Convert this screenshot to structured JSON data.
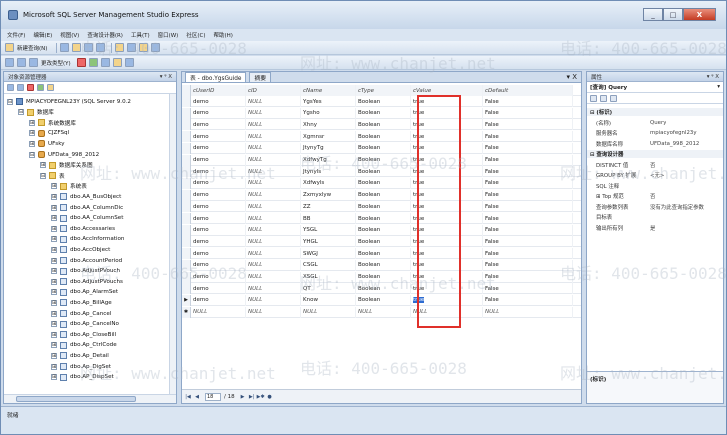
{
  "window": {
    "title": "Microsoft SQL Server Management Studio Express",
    "min": "_",
    "max": "□",
    "close": "X"
  },
  "menu": [
    "文件(F)",
    "编辑(E)",
    "视图(V)",
    "查询设计器(R)",
    "工具(T)",
    "窗口(W)",
    "社区(C)",
    "帮助(H)"
  ],
  "toolbar1": {
    "new_query": "新建查询(N)"
  },
  "toolbar2": {
    "change_type": "更改类型(Y)"
  },
  "object_explorer": {
    "title": "对象资源管理器",
    "controls": "▾ ᵠ X",
    "tree": [
      {
        "label": "MPIACYOFEGNL23Y (SQL Server 9.0.2",
        "exp": "⊟",
        "icon": "server",
        "level": 0
      },
      {
        "label": "数据库",
        "exp": "⊟",
        "icon": "folder",
        "level": 1
      },
      {
        "label": "系统数据库",
        "exp": "⊞",
        "icon": "folder",
        "level": 2
      },
      {
        "label": "CJZFSql",
        "exp": "⊞",
        "icon": "db",
        "level": 2
      },
      {
        "label": "UFsky",
        "exp": "⊞",
        "icon": "db",
        "level": 2
      },
      {
        "label": "UFData_998_2012",
        "exp": "⊟",
        "icon": "db",
        "level": 2
      },
      {
        "label": "数据库关系图",
        "exp": "⊞",
        "icon": "folder",
        "level": 3
      },
      {
        "label": "表",
        "exp": "⊟",
        "icon": "folder",
        "level": 3
      },
      {
        "label": "系统表",
        "exp": "⊞",
        "icon": "folder",
        "level": 4
      },
      {
        "label": "dbo.AA_BusObject",
        "exp": "⊞",
        "icon": "table",
        "level": 4
      },
      {
        "label": "dbo.AA_ColumnDic",
        "exp": "⊞",
        "icon": "table",
        "level": 4
      },
      {
        "label": "dbo.AA_ColumnSet",
        "exp": "⊞",
        "icon": "table",
        "level": 4
      },
      {
        "label": "dbo.Accessaries",
        "exp": "⊞",
        "icon": "table",
        "level": 4
      },
      {
        "label": "dbo.AccInformation",
        "exp": "⊞",
        "icon": "table",
        "level": 4
      },
      {
        "label": "dbo.AccObject",
        "exp": "⊞",
        "icon": "table",
        "level": 4
      },
      {
        "label": "dbo.AccountPeriod",
        "exp": "⊞",
        "icon": "table",
        "level": 4
      },
      {
        "label": "dbo.AdjustPVouch",
        "exp": "⊞",
        "icon": "table",
        "level": 4
      },
      {
        "label": "dbo.AdjustPVouchs",
        "exp": "⊞",
        "icon": "table",
        "level": 4
      },
      {
        "label": "dbo.Ap_AlarmSet",
        "exp": "⊞",
        "icon": "table",
        "level": 4
      },
      {
        "label": "dbo.Ap_BillAge",
        "exp": "⊞",
        "icon": "table",
        "level": 4
      },
      {
        "label": "dbo.Ap_Cancel",
        "exp": "⊞",
        "icon": "table",
        "level": 4
      },
      {
        "label": "dbo.Ap_CancelNo",
        "exp": "⊞",
        "icon": "table",
        "level": 4
      },
      {
        "label": "dbo.Ap_CloseBill",
        "exp": "⊞",
        "icon": "table",
        "level": 4
      },
      {
        "label": "dbo.Ap_CtrlCode",
        "exp": "⊞",
        "icon": "table",
        "level": 4
      },
      {
        "label": "dbo.Ap_Detail",
        "exp": "⊞",
        "icon": "table",
        "level": 4
      },
      {
        "label": "dbo.Ap_DigSet",
        "exp": "⊞",
        "icon": "table",
        "level": 4
      },
      {
        "label": "dbo.AP_DispSet",
        "exp": "⊞",
        "icon": "table",
        "level": 4
      }
    ]
  },
  "editor": {
    "tab_active": "表 - dbo.YgsGuide",
    "tab_inactive": "摘要",
    "tab_controls": "▾ X",
    "columns": [
      "cUserID",
      "cID",
      "cName",
      "cType",
      "cValue",
      "cDefault"
    ],
    "rows": [
      {
        "sel": "",
        "cells": [
          "demo",
          "NULL",
          "YgsYes",
          "Boolean",
          "true",
          "False"
        ]
      },
      {
        "sel": "",
        "cells": [
          "demo",
          "NULL",
          "Ygsho",
          "Boolean",
          "true",
          "False"
        ]
      },
      {
        "sel": "",
        "cells": [
          "demo",
          "NULL",
          "Xhny",
          "Boolean",
          "true",
          "False"
        ]
      },
      {
        "sel": "",
        "cells": [
          "demo",
          "NULL",
          "Xgmnsr",
          "Boolean",
          "true",
          "False"
        ]
      },
      {
        "sel": "",
        "cells": [
          "demo",
          "NULL",
          "JtynyTg",
          "Boolean",
          "true",
          "False"
        ]
      },
      {
        "sel": "",
        "cells": [
          "demo",
          "NULL",
          "XdfwyTg",
          "Boolean",
          "true",
          "False"
        ]
      },
      {
        "sel": "",
        "cells": [
          "demo",
          "NULL",
          "Jtynyls",
          "Boolean",
          "true",
          "False"
        ]
      },
      {
        "sel": "",
        "cells": [
          "demo",
          "NULL",
          "Xdfwyls",
          "Boolean",
          "true",
          "False"
        ]
      },
      {
        "sel": "",
        "cells": [
          "demo",
          "NULL",
          "Zxmyxlyw",
          "Boolean",
          "true",
          "False"
        ]
      },
      {
        "sel": "",
        "cells": [
          "demo",
          "NULL",
          "ZZ",
          "Boolean",
          "true",
          "False"
        ]
      },
      {
        "sel": "",
        "cells": [
          "demo",
          "NULL",
          "BB",
          "Boolean",
          "true",
          "False"
        ]
      },
      {
        "sel": "",
        "cells": [
          "demo",
          "NULL",
          "YSGL",
          "Boolean",
          "true",
          "False"
        ]
      },
      {
        "sel": "",
        "cells": [
          "demo",
          "NULL",
          "YHGL",
          "Boolean",
          "true",
          "False"
        ]
      },
      {
        "sel": "",
        "cells": [
          "demo",
          "NULL",
          "SWGJ",
          "Boolean",
          "true",
          "False"
        ]
      },
      {
        "sel": "",
        "cells": [
          "demo",
          "NULL",
          "CSGL",
          "Boolean",
          "true",
          "False"
        ]
      },
      {
        "sel": "",
        "cells": [
          "demo",
          "NULL",
          "XSGL",
          "Boolean",
          "true",
          "False"
        ]
      },
      {
        "sel": "",
        "cells": [
          "demo",
          "NULL",
          "QT",
          "Boolean",
          "true",
          "False"
        ]
      },
      {
        "sel": "▶",
        "cells": [
          "demo",
          "NULL",
          "Know",
          "Boolean",
          "true",
          "False"
        ]
      },
      {
        "sel": "✱",
        "cells": [
          "NULL",
          "NULL",
          "NULL",
          "NULL",
          "NULL",
          "NULL"
        ]
      }
    ],
    "nav": {
      "first": "|◀",
      "prev": "◀",
      "current": "18",
      "of": "/ 18",
      "next": "▶",
      "last": "▶|",
      "new": "▶✱",
      "stop": "●"
    }
  },
  "properties": {
    "title": "属性",
    "controls": "▾ ᵠ X",
    "selected": "[查询] Query",
    "rows": [
      {
        "type": "cat",
        "k": "⊟ (标识)"
      },
      {
        "type": "kv",
        "k": "(名称)",
        "v": "Query"
      },
      {
        "type": "kv",
        "k": "服务器名",
        "v": "mpiacyofegnl23y"
      },
      {
        "type": "kv",
        "k": "数据库名称",
        "v": "UFData_998_2012"
      },
      {
        "type": "cat",
        "k": "⊟ 查询设计器"
      },
      {
        "type": "kv",
        "k": "DISTINCT 值",
        "v": "否"
      },
      {
        "type": "kv",
        "k": "GROUP BY 扩展",
        "v": "<无>"
      },
      {
        "type": "kv",
        "k": "SQL 注释",
        "v": ""
      },
      {
        "type": "kv",
        "k": "⊞ Top 规范",
        "v": "否"
      },
      {
        "type": "kv",
        "k": "查询参数列表",
        "v": "没有为此查询指定参数"
      },
      {
        "type": "kv",
        "k": "目标表",
        "v": ""
      },
      {
        "type": "kv",
        "k": "输出所有列",
        "v": "是"
      }
    ],
    "desc": "(标识)"
  },
  "status": "就绪",
  "watermarks": [
    "电话: 400-665-0028",
    "网址: www.chanjet.net"
  ]
}
